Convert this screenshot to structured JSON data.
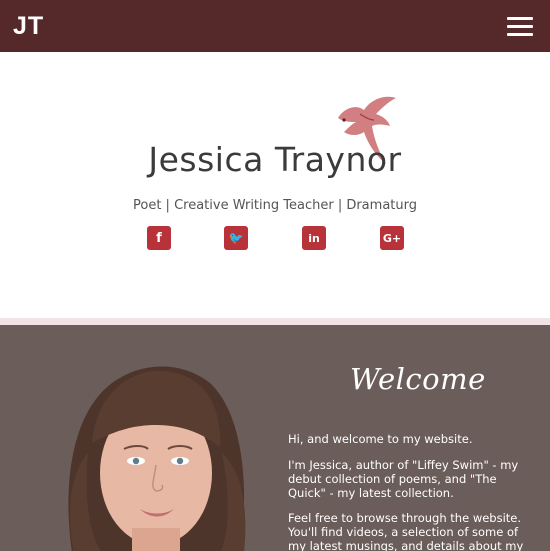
{
  "colors": {
    "brand": "#55282a",
    "accent": "#b8323a",
    "welcome_bg": "#6b5d59"
  },
  "header": {
    "logo": "JT",
    "menu_icon": "hamburger-menu-icon"
  },
  "hero": {
    "name": "Jessica Traynor",
    "tagline": "Poet | Creative Writing Teacher | Dramaturg",
    "social": [
      {
        "name": "facebook",
        "icon": "f"
      },
      {
        "name": "twitter",
        "icon": "🐦"
      },
      {
        "name": "linkedin",
        "icon": "in"
      },
      {
        "name": "google-plus",
        "icon": "G+"
      }
    ]
  },
  "welcome": {
    "title": "Welcome",
    "paragraphs": [
      "Hi, and welcome to my website.",
      "I'm Jessica, author of \"Liffey Swim\" - my debut collection of poems, and \"The Quick\" - my latest collection.",
      "Feel free to browse through the website. You'll find videos, a selection of some of my latest musings, and details about my books"
    ]
  }
}
